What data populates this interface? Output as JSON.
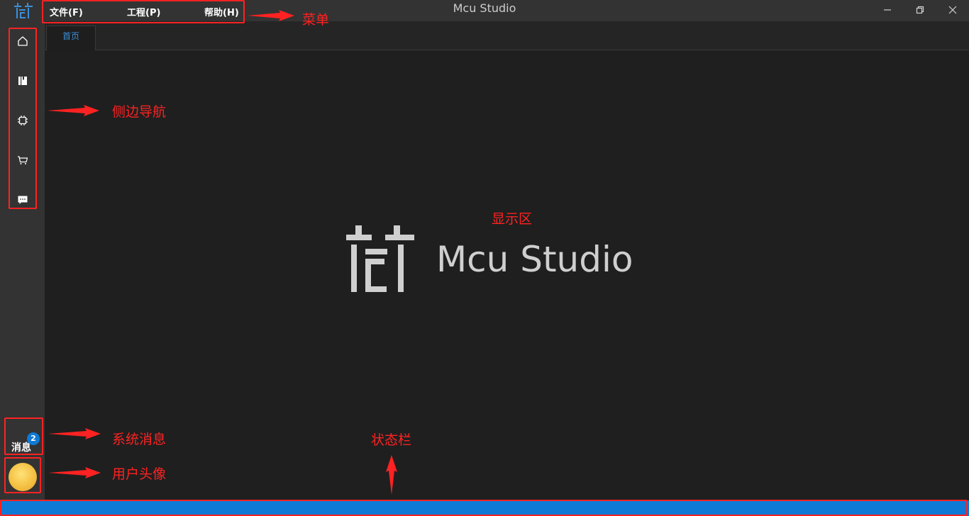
{
  "window": {
    "title": "Mcu Studio"
  },
  "menu": {
    "items": [
      "文件(F)",
      "工程(P)",
      "帮助(H)"
    ]
  },
  "sidebar": {
    "nav": [
      "home-icon",
      "book-icon",
      "chip-icon",
      "cart-icon",
      "chat-icon"
    ],
    "messages": {
      "label": "消息",
      "badge": "2"
    }
  },
  "tabs": [
    {
      "label": "首页"
    }
  ],
  "main": {
    "product_name": "Mcu Studio"
  },
  "annotations": {
    "menu": "菜单",
    "side_nav": "侧边导航",
    "display_area": "显示区",
    "system_messages": "系统消息",
    "user_avatar": "用户头像",
    "status_bar": "状态栏"
  },
  "colors": {
    "accent": "#0e7ad6",
    "annotation": "#ff2222",
    "sidebar_bg": "#333333",
    "main_bg": "#1f1f1f"
  }
}
